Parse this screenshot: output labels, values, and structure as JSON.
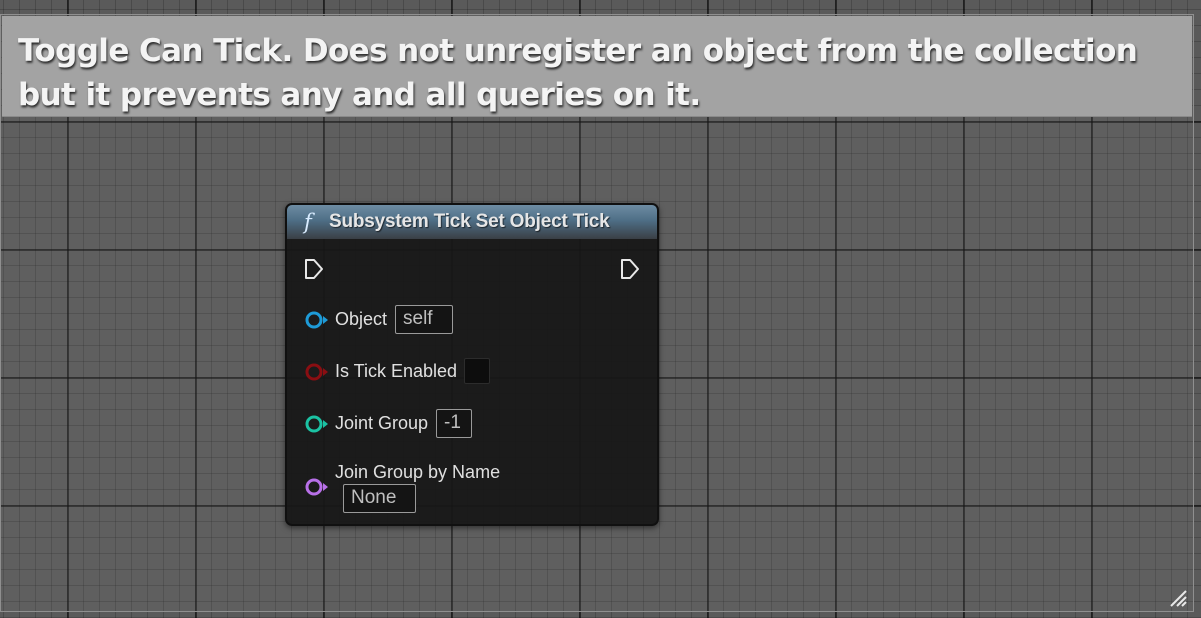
{
  "comment": {
    "text": "Toggle Can Tick. Does not unregister an object from the collection but it prevents any and all queries on it."
  },
  "node": {
    "icon": "function-icon",
    "icon_glyph": "f",
    "title": "Subsystem Tick Set Object Tick",
    "pins": {
      "object": {
        "label": "Object",
        "value": "self",
        "color": "#1e9bd8"
      },
      "is_tick_enabled": {
        "label": "Is Tick Enabled",
        "checked": false,
        "color": "#8a0e12"
      },
      "joint_group": {
        "label": "Joint Group",
        "value": "-1",
        "color": "#1bc2a3"
      },
      "join_group_by_name": {
        "label": "Join Group by Name",
        "value": "None",
        "color": "#b870e8"
      }
    }
  }
}
